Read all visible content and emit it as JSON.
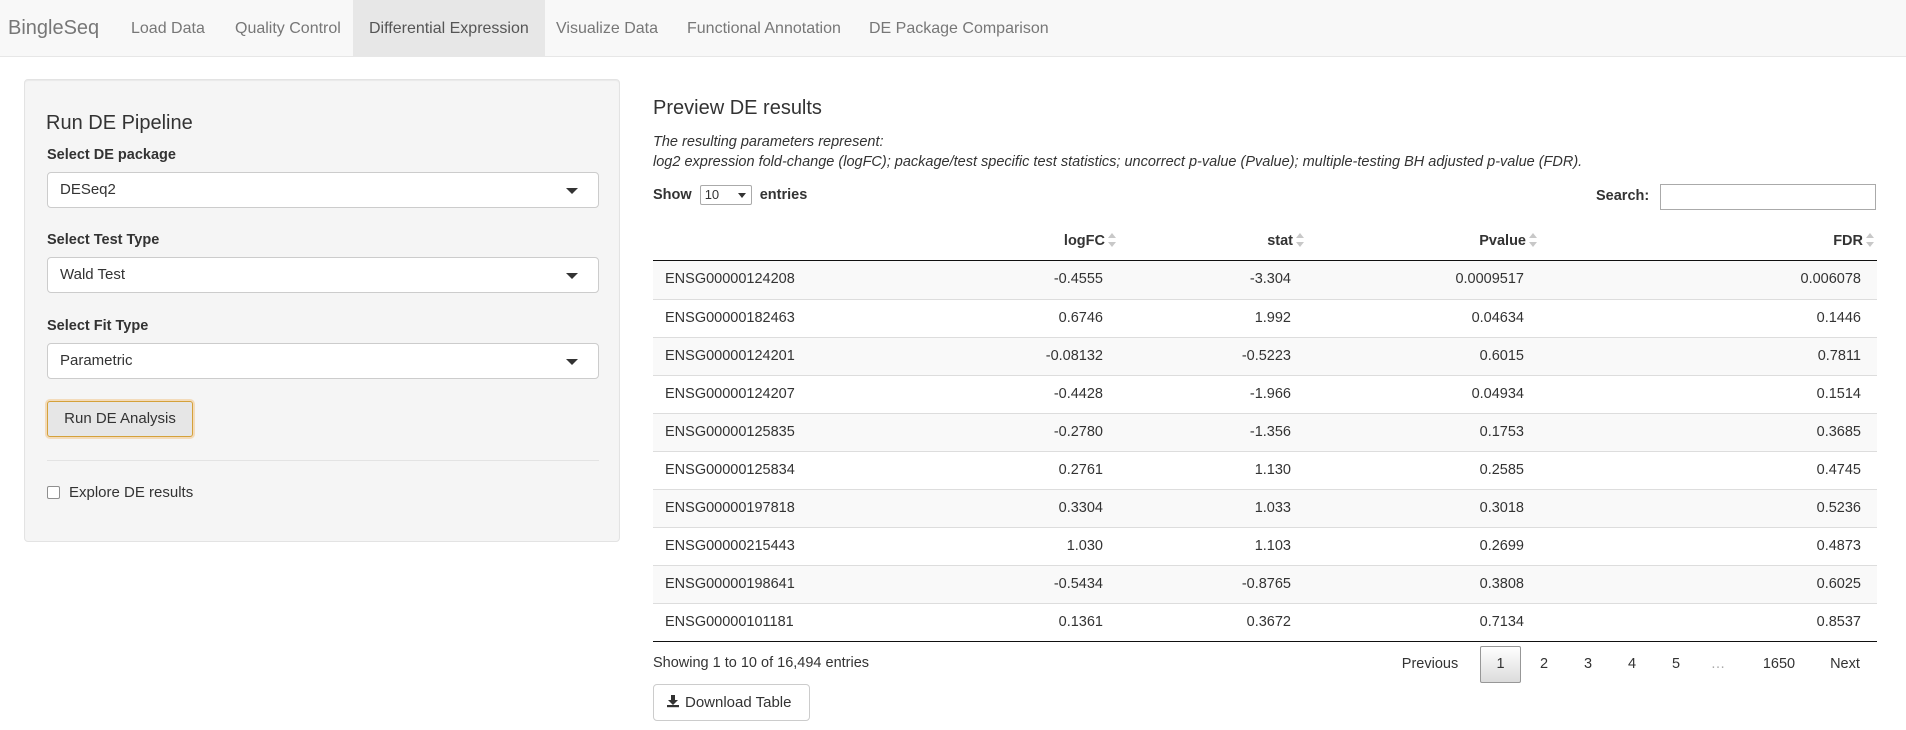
{
  "navbar": {
    "brand": "BingleSeq",
    "tabs": [
      {
        "label": "Load Data"
      },
      {
        "label": "Quality Control"
      },
      {
        "label": "Differential Expression",
        "active": true
      },
      {
        "label": "Visualize Data"
      },
      {
        "label": "Functional Annotation"
      },
      {
        "label": "DE Package Comparison"
      }
    ]
  },
  "sidebar": {
    "title": "Run DE Pipeline",
    "package": {
      "label": "Select DE package",
      "value": "DESeq2"
    },
    "test_type": {
      "label": "Select Test Type",
      "value": "Wald Test"
    },
    "fit_type": {
      "label": "Select Fit Type",
      "value": "Parametric"
    },
    "run_button": "Run DE Analysis",
    "explore_checkbox": {
      "label": "Explore DE results",
      "checked": false
    }
  },
  "main": {
    "title": "Preview DE results",
    "desc_line1": "The resulting parameters represent:",
    "desc_line2": "log2 expression fold-change (logFC); package/test specific test statistics; uncorrect p-value (Pvalue); multiple-testing BH adjusted p-value (FDR).",
    "show_label": "Show",
    "page_length": "10",
    "entries_label": "entries",
    "search_label": "Search:",
    "search_value": "",
    "columns": [
      "",
      "logFC",
      "stat",
      "Pvalue",
      "FDR"
    ],
    "rows": [
      [
        "ENSG00000124208",
        "-0.4555",
        "-3.304",
        "0.0009517",
        "0.006078"
      ],
      [
        "ENSG00000182463",
        "0.6746",
        "1.992",
        "0.04634",
        "0.1446"
      ],
      [
        "ENSG00000124201",
        "-0.08132",
        "-0.5223",
        "0.6015",
        "0.7811"
      ],
      [
        "ENSG00000124207",
        "-0.4428",
        "-1.966",
        "0.04934",
        "0.1514"
      ],
      [
        "ENSG00000125835",
        "-0.2780",
        "-1.356",
        "0.1753",
        "0.3685"
      ],
      [
        "ENSG00000125834",
        "0.2761",
        "1.130",
        "0.2585",
        "0.4745"
      ],
      [
        "ENSG00000197818",
        "0.3304",
        "1.033",
        "0.3018",
        "0.5236"
      ],
      [
        "ENSG00000215443",
        "1.030",
        "1.103",
        "0.2699",
        "0.4873"
      ],
      [
        "ENSG00000198641",
        "-0.5434",
        "-0.8765",
        "0.3808",
        "0.6025"
      ],
      [
        "ENSG00000101181",
        "0.1361",
        "0.3672",
        "0.7134",
        "0.8537"
      ]
    ],
    "info": "Showing 1 to 10 of 16,494 entries",
    "pagination": {
      "previous": "Previous",
      "pages": [
        "1",
        "2",
        "3",
        "4",
        "5"
      ],
      "current": "1",
      "ellipsis": "…",
      "last": "1650",
      "next": "Next"
    },
    "download_button": "Download Table"
  },
  "icons": {
    "download": "download-icon",
    "dropdown": "caret-down-icon",
    "sort": "sort-icon"
  },
  "colors": {
    "navbar_bg": "#f8f8f8",
    "active_tab_bg": "#e7e7e7",
    "well_bg": "#f5f5f5",
    "focus_border": "#d4a13a"
  }
}
